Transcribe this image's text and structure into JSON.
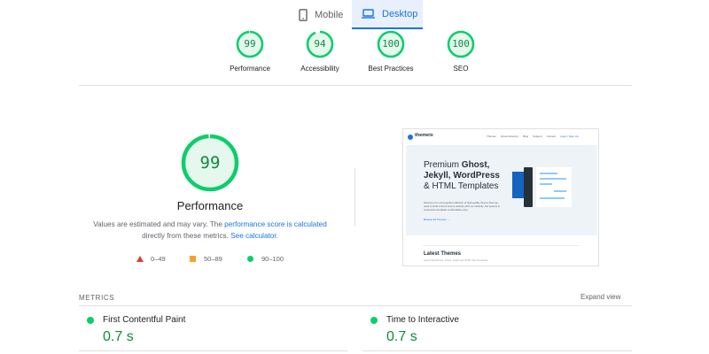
{
  "tabs": [
    {
      "label": "Mobile",
      "icon": "phone-icon",
      "active": false
    },
    {
      "label": "Desktop",
      "icon": "laptop-icon",
      "active": true
    }
  ],
  "categories": [
    {
      "score": "99",
      "label": "Performance",
      "value": 99
    },
    {
      "score": "94",
      "label": "Accessibility",
      "value": 94
    },
    {
      "score": "100",
      "label": "Best Practices",
      "value": 100
    },
    {
      "score": "100",
      "label": "SEO",
      "value": 100
    }
  ],
  "performance": {
    "score": "99",
    "value": 99,
    "title": "Performance",
    "desc_prefix": "Values are estimated and may vary. The ",
    "desc_link": "performance score is calculated",
    "desc_middle": " directly from these metrics. ",
    "desc_link2": "See calculator."
  },
  "legend": {
    "fail": "0–49",
    "average": "50–89",
    "pass": "90–100"
  },
  "colors": {
    "pass": "#0cce6b",
    "pass_text": "#0c8d3d",
    "average": "#fb9f2c",
    "fail": "#e53935",
    "accent": "#1a73e8"
  },
  "thumbnail": {
    "logo": "themeix",
    "nav": [
      "Themes",
      "Ghost directory",
      "Blog",
      "Support",
      "Contact",
      "Login / Sign Up"
    ],
    "headline_1": "Premium ",
    "headline_bold_1": "Ghost,",
    "headline_bold_2": "Jekyll, WordPress",
    "headline_3": "& HTML Templates",
    "small_text": "Discover our most popular collection of high-quality themes that you need to build a fast & secure website with our carefully. Get speedy & responsive templates at affordable price.",
    "browse": "Browse All Themes →",
    "latest": "Latest Themes",
    "latest_sub": "Latest WordPress, Ghost, Jekyll and HTML Site Templates"
  },
  "metrics": {
    "label": "METRICS",
    "expand": "Expand view",
    "items": [
      {
        "name": "First Contentful Paint",
        "value": "0.7 s"
      },
      {
        "name": "Time to Interactive",
        "value": "0.7 s"
      }
    ]
  }
}
